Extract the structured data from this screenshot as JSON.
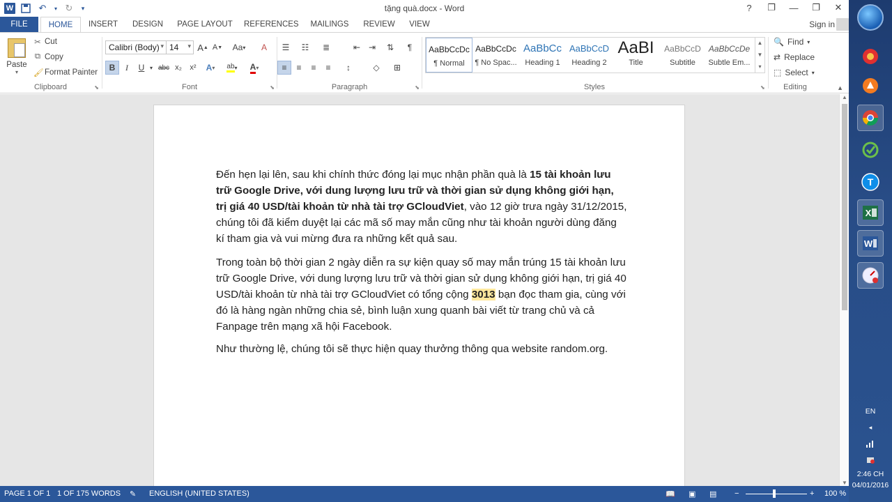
{
  "window": {
    "title": "tặng quà.docx - Word",
    "controls": [
      "?",
      "❐",
      "—",
      "❐",
      "✕"
    ]
  },
  "tabs": [
    "FILE",
    "HOME",
    "INSERT",
    "DESIGN",
    "PAGE LAYOUT",
    "REFERENCES",
    "MAILINGS",
    "REVIEW",
    "VIEW"
  ],
  "active_tab": "HOME",
  "signin": "Sign in",
  "ribbon": {
    "clipboard": {
      "label": "Clipboard",
      "paste": "Paste",
      "cut": "Cut",
      "copy": "Copy",
      "format_painter": "Format Painter"
    },
    "font": {
      "label": "Font",
      "family": "Calibri (Body)",
      "size": "14",
      "bold": "B",
      "italic": "I",
      "underline": "U",
      "strike": "abc",
      "subscript": "x₂",
      "superscript": "x²",
      "grow": "A",
      "shrink": "A",
      "case": "Aa",
      "clear": "A",
      "text_effects": "A",
      "highlight": "ab",
      "font_color": "A"
    },
    "paragraph": {
      "label": "Paragraph"
    },
    "styles": {
      "label": "Styles",
      "items": [
        {
          "sample": "AaBbCcDc",
          "name": "¶ Normal"
        },
        {
          "sample": "AaBbCcDc",
          "name": "¶ No Spac..."
        },
        {
          "sample": "AaBbCc",
          "name": "Heading 1"
        },
        {
          "sample": "AaBbCcD",
          "name": "Heading 2"
        },
        {
          "sample": "AaBI",
          "name": "Title"
        },
        {
          "sample": "AaBbCcD",
          "name": "Subtitle"
        },
        {
          "sample": "AaBbCcDe",
          "name": "Subtle Em..."
        }
      ]
    },
    "editing": {
      "label": "Editing",
      "find": "Find",
      "replace": "Replace",
      "select": "Select"
    }
  },
  "document": {
    "p1_a": "Đến hẹn lại lên, sau khi chính thức đóng lại mục nhận phần quà là ",
    "p1_bold": "15 tài khoản lưu trữ Google Drive, với dung lượng lưu trữ và thời gian sử dụng không giới hạn, trị giá 40 USD/tài khoản từ nhà tài trợ GCloudViet",
    "p1_b": ", vào 12 giờ trưa ngày 31/12/2015, chúng tôi đã kiểm duyệt lại các mã số may mắn cũng như tài khoản người dùng đăng kí tham gia và vui mừng đưa ra những kết quả sau.",
    "p2_a": "Trong toàn bộ thời gian 2 ngày diễn ra sự kiện quay số may mắn trúng 15 tài khoản lưu trữ Google Drive, với dung lượng lưu trữ và thời gian sử dụng không giới hạn, trị giá 40 USD/tài khoản từ nhà tài trợ GCloudViet có tổng cộng ",
    "p2_bold": "3013",
    "p2_b": " bạn đọc tham gia, cùng với đó là hàng ngàn những chia sẻ, bình luận xung quanh bài viết từ trang chủ và cả Fanpage trên mạng xã hội Facebook.",
    "p3": "Như thường lệ, chúng tôi sẽ thực hiện quay thưởng thông qua website random.org."
  },
  "status": {
    "page": "PAGE 1 OF 1",
    "words": "1 OF 175 WORDS",
    "language": "ENGLISH (UNITED STATES)",
    "zoom": "100 %"
  },
  "taskbar": {
    "apps": [
      "chrome-icon",
      "green-app-icon",
      "teamviewer-icon",
      "excel-icon",
      "word-icon",
      "speed-icon"
    ],
    "lang": "EN",
    "time": "2:46 CH",
    "date": "04/01/2016"
  }
}
